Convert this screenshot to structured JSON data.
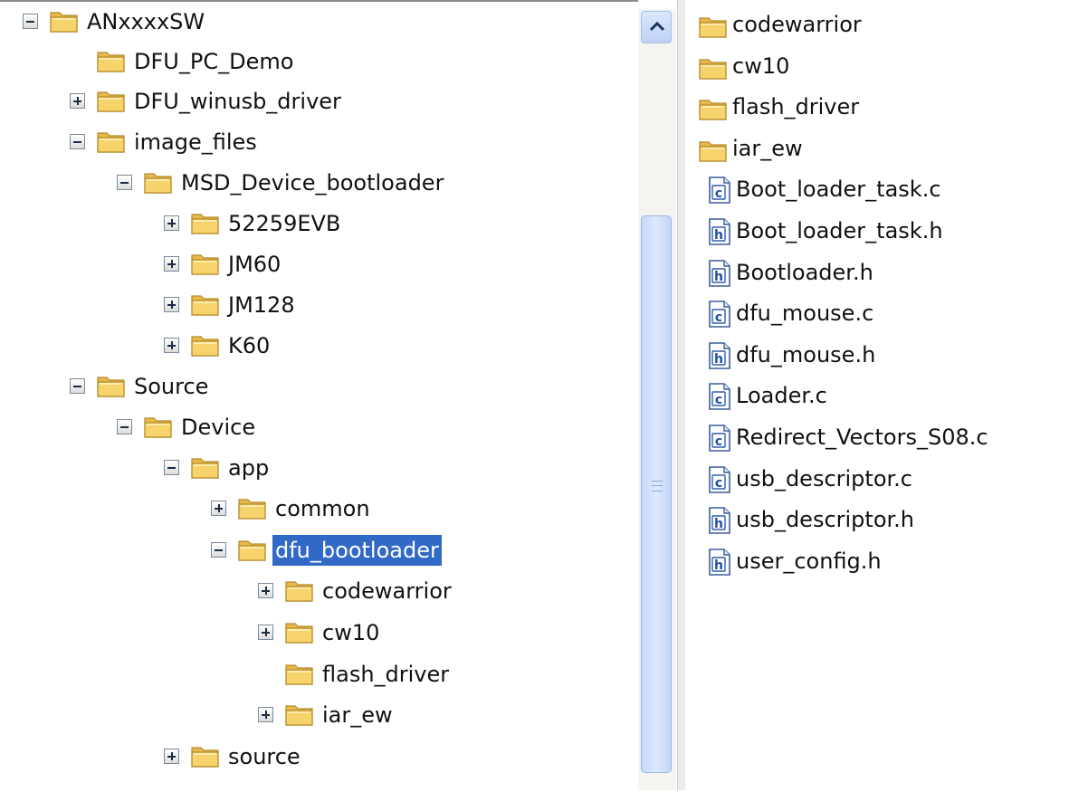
{
  "tree": {
    "nodes": [
      {
        "label": "ANxxxxSW",
        "toggle": "minus"
      },
      {
        "label": "DFU_PC_Demo",
        "toggle": "none"
      },
      {
        "label": "DFU_winusb_driver",
        "toggle": "plus"
      },
      {
        "label": "image_files",
        "toggle": "minus"
      },
      {
        "label": "MSD_Device_bootloader",
        "toggle": "minus"
      },
      {
        "label": "52259EVB",
        "toggle": "plus"
      },
      {
        "label": "JM60",
        "toggle": "plus"
      },
      {
        "label": "JM128",
        "toggle": "plus"
      },
      {
        "label": "K60",
        "toggle": "plus"
      },
      {
        "label": "Source",
        "toggle": "minus"
      },
      {
        "label": "Device",
        "toggle": "minus"
      },
      {
        "label": "app",
        "toggle": "minus"
      },
      {
        "label": "common",
        "toggle": "plus"
      },
      {
        "label": "dfu_bootloader",
        "toggle": "minus",
        "selected": true
      },
      {
        "label": "codewarrior",
        "toggle": "plus"
      },
      {
        "label": "cw10",
        "toggle": "plus"
      },
      {
        "label": "flash_driver",
        "toggle": "none"
      },
      {
        "label": "iar_ew",
        "toggle": "plus"
      },
      {
        "label": "source",
        "toggle": "plus"
      }
    ]
  },
  "files": {
    "items": [
      {
        "name": "codewarrior",
        "icon": "folder-icon"
      },
      {
        "name": "cw10",
        "icon": "folder-icon"
      },
      {
        "name": "flash_driver",
        "icon": "folder-icon"
      },
      {
        "name": "iar_ew",
        "icon": "folder-icon"
      },
      {
        "name": "Boot_loader_task.c",
        "icon": "c-file-icon"
      },
      {
        "name": "Boot_loader_task.h",
        "icon": "h-file-icon"
      },
      {
        "name": "Bootloader.h",
        "icon": "h-file-icon"
      },
      {
        "name": "dfu_mouse.c",
        "icon": "c-file-icon"
      },
      {
        "name": "dfu_mouse.h",
        "icon": "h-file-icon"
      },
      {
        "name": "Loader.c",
        "icon": "c-file-icon"
      },
      {
        "name": "Redirect_Vectors_S08.c",
        "icon": "c-file-icon"
      },
      {
        "name": "usb_descriptor.c",
        "icon": "c-file-icon"
      },
      {
        "name": "usb_descriptor.h",
        "icon": "h-file-icon"
      },
      {
        "name": "user_config.h",
        "icon": "h-file-icon"
      }
    ]
  },
  "colors": {
    "selection": "#3169c6",
    "folder": "#f7d46b",
    "scroll_thumb": "#c8dafa"
  }
}
